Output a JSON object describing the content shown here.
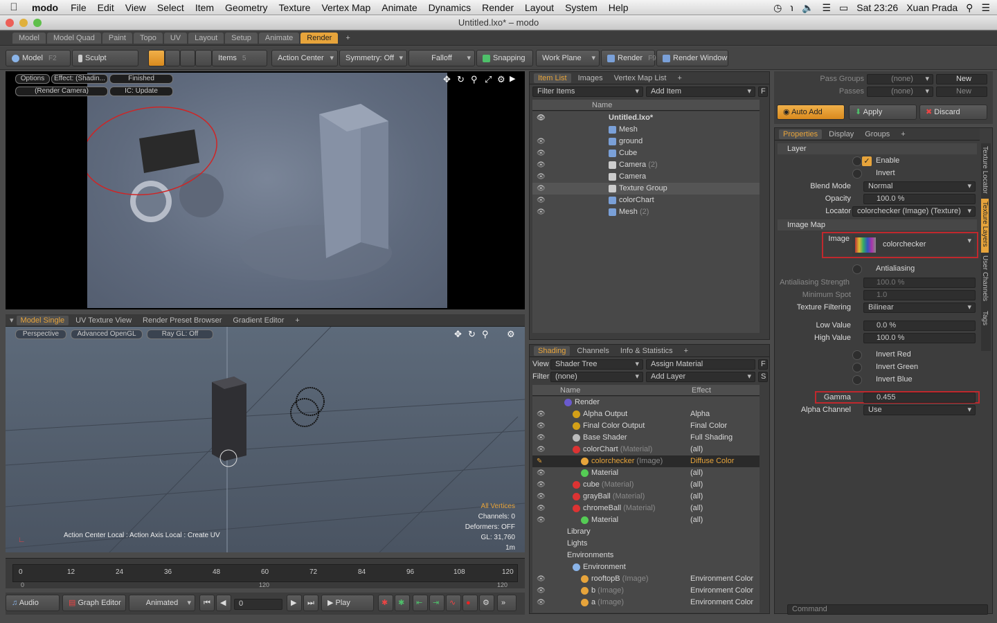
{
  "mac_menubar": {
    "app": "modo",
    "menus": [
      "File",
      "Edit",
      "View",
      "Select",
      "Item",
      "Geometry",
      "Texture",
      "Vertex Map",
      "Animate",
      "Dynamics",
      "Render",
      "Layout",
      "System",
      "Help"
    ],
    "clock": "Sat 23:26",
    "user": "Xuan Prada"
  },
  "window": {
    "title": "Untitled.lxo* – modo"
  },
  "layout_tabs": [
    "Model",
    "Model Quad",
    "Paint",
    "Topo",
    "UV",
    "Layout",
    "Setup",
    "Animate",
    "Render"
  ],
  "toolbar": {
    "model": "Model",
    "model_key": "F2",
    "sculpt": "Sculpt",
    "items": "Items",
    "items_key": "5",
    "action_center": "Action Center",
    "symmetry": "Symmetry: Off",
    "falloff": "Falloff",
    "snapping": "Snapping",
    "work_plane": "Work Plane",
    "render": "Render",
    "render_key": "F9",
    "render_window": "Render Window"
  },
  "render_view": {
    "options": "Options",
    "effect": "Effect: (Shadin...",
    "finished": "Finished",
    "camera": "(Render Camera)",
    "ic": "IC: Update"
  },
  "view_tabs": [
    "Model Single",
    "UV Texture View",
    "Render Preset Browser",
    "Gradient Editor"
  ],
  "view3d": {
    "perspective": "Perspective",
    "gl": "Advanced OpenGL",
    "raygl": "Ray GL: Off",
    "status_left": "Action Center Local : Action Axis Local : Create UV",
    "info": [
      "All Vertices",
      "Channels: 0",
      "Deformers: OFF",
      "GL: 31,760",
      "1m"
    ]
  },
  "timeline": {
    "ticks": [
      "0",
      "12",
      "24",
      "36",
      "48",
      "60",
      "72",
      "84",
      "96",
      "108",
      "120"
    ],
    "sub": [
      "0",
      "120",
      "120"
    ]
  },
  "bottombar": {
    "audio": "Audio",
    "graph_editor": "Graph Editor",
    "animated": "Animated",
    "frame": "0",
    "play": "Play"
  },
  "item_list": {
    "tabs": [
      "Item List",
      "Images",
      "Vertex Map List"
    ],
    "filter": "Filter Items",
    "add_item": "Add Item",
    "col_name": "Name",
    "rows": [
      {
        "name": "Untitled.lxo*",
        "suffix": ""
      },
      {
        "name": "Mesh",
        "suffix": ""
      },
      {
        "name": "ground",
        "suffix": ""
      },
      {
        "name": "Cube",
        "suffix": ""
      },
      {
        "name": "Camera",
        "suffix": "(2)"
      },
      {
        "name": "Camera",
        "suffix": ""
      },
      {
        "name": "Texture Group",
        "suffix": ""
      },
      {
        "name": "colorChart",
        "suffix": ""
      },
      {
        "name": "Mesh",
        "suffix": "(2)"
      }
    ]
  },
  "shading": {
    "tabs": [
      "Shading",
      "Channels",
      "Info & Statistics"
    ],
    "view_label": "View",
    "view_value": "Shader Tree",
    "assign_material": "Assign Material",
    "filter_label": "Filter",
    "filter_value": "(none)",
    "add_layer": "Add Layer",
    "col_name": "Name",
    "col_effect": "Effect",
    "rows": [
      {
        "name": "Render",
        "suffix": "",
        "effect": ""
      },
      {
        "name": "Alpha Output",
        "suffix": "",
        "effect": "Alpha"
      },
      {
        "name": "Final Color Output",
        "suffix": "",
        "effect": "Final Color"
      },
      {
        "name": "Base Shader",
        "suffix": "",
        "effect": "Full Shading"
      },
      {
        "name": "colorChart",
        "suffix": "(Material)",
        "effect": "(all)"
      },
      {
        "name": "colorchecker",
        "suffix": "(Image)",
        "effect": "Diffuse Color"
      },
      {
        "name": "Material",
        "suffix": "",
        "effect": "(all)"
      },
      {
        "name": "cube",
        "suffix": "(Material)",
        "effect": "(all)"
      },
      {
        "name": "grayBall",
        "suffix": "(Material)",
        "effect": "(all)"
      },
      {
        "name": "chromeBall",
        "suffix": "(Material)",
        "effect": "(all)"
      },
      {
        "name": "Material",
        "suffix": "",
        "effect": "(all)"
      },
      {
        "name": "Library",
        "suffix": "",
        "effect": ""
      },
      {
        "name": "Lights",
        "suffix": "",
        "effect": ""
      },
      {
        "name": "Environments",
        "suffix": "",
        "effect": ""
      },
      {
        "name": "Environment",
        "suffix": "",
        "effect": ""
      },
      {
        "name": "rooftopB",
        "suffix": "(Image)",
        "effect": "Environment Color"
      },
      {
        "name": "b",
        "suffix": "(Image)",
        "effect": "Environment Color"
      },
      {
        "name": "a",
        "suffix": "(Image)",
        "effect": "Environment Color"
      }
    ]
  },
  "pass_groups": {
    "label": "Pass Groups",
    "value": "(none)",
    "new": "New",
    "passes": "Passes",
    "passes_value": "(none)",
    "passes_new": "New"
  },
  "actions": {
    "auto_add": "Auto Add",
    "apply": "Apply",
    "discard": "Discard"
  },
  "properties": {
    "tabs": [
      "Properties",
      "Display",
      "Groups"
    ],
    "side_tabs": [
      "Texture Locator",
      "Texture Layers",
      "User Channels",
      "Tags"
    ],
    "layer_section": "Layer",
    "enable": "Enable",
    "invert": "Invert",
    "blend_mode_label": "Blend Mode",
    "blend_mode": "Normal",
    "opacity_label": "Opacity",
    "opacity": "100.0 %",
    "locator_label": "Locator",
    "locator": "colorchecker (Image) (Texture)",
    "image_map_section": "Image Map",
    "image_label": "Image",
    "image": "colorchecker",
    "antialiasing": "Antialiasing",
    "aa_strength_label": "Antialiasing Strength",
    "aa_strength": "100.0 %",
    "min_spot_label": "Minimum Spot",
    "min_spot": "1.0",
    "tex_filter_label": "Texture Filtering",
    "tex_filter": "Bilinear",
    "low_label": "Low Value",
    "low": "0.0 %",
    "high_label": "High Value",
    "high": "100.0 %",
    "invert_red": "Invert Red",
    "invert_green": "Invert Green",
    "invert_blue": "Invert Blue",
    "gamma_label": "Gamma",
    "gamma": "0.455",
    "alpha_label": "Alpha Channel",
    "alpha": "Use"
  },
  "command_placeholder": "Command",
  "colors": {
    "accent": "#e7a43b",
    "highlight": "#c0282d"
  }
}
